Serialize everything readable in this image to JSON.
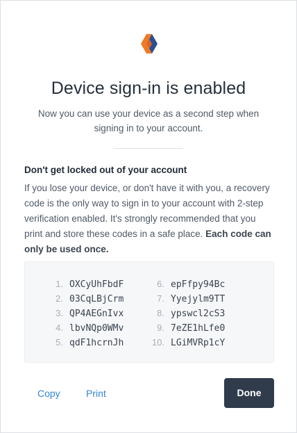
{
  "logo": {
    "icon": "app-logo-icon",
    "colors": [
      "#f07a22",
      "#2d4e8f"
    ]
  },
  "title": "Device sign-in is enabled",
  "subtitle": "Now you can use your device as a second step when signing in to your account.",
  "warning": {
    "heading": "Don't get locked out of your account",
    "body": "If you lose your device, or don't have it with you, a recovery code is the only way to sign in to your account with 2-step verification enabled. It's strongly recommended that you print and store these codes in a safe place. ",
    "emphasis": "Each code can only be used once."
  },
  "codes": [
    {
      "num": "1.",
      "code": "OXCyUhFbdF"
    },
    {
      "num": "2.",
      "code": "03CqLBjCrm"
    },
    {
      "num": "3.",
      "code": "QP4AEGnIvx"
    },
    {
      "num": "4.",
      "code": "lbvNQp0WMv"
    },
    {
      "num": "5.",
      "code": "qdF1hcrnJh"
    },
    {
      "num": "6.",
      "code": "epFfpy94Bc"
    },
    {
      "num": "7.",
      "code": "Yyejylm9TT"
    },
    {
      "num": "8.",
      "code": "ypswcl2cS3"
    },
    {
      "num": "9.",
      "code": "7eZE1hLfe0"
    },
    {
      "num": "10.",
      "code": "LGiMVRp1cY"
    }
  ],
  "actions": {
    "copy_label": "Copy",
    "print_label": "Print",
    "done_label": "Done"
  },
  "colors": {
    "accent": "#2f86d6",
    "primary_button": "#303c4b",
    "codes_background": "#f6f7f8"
  }
}
